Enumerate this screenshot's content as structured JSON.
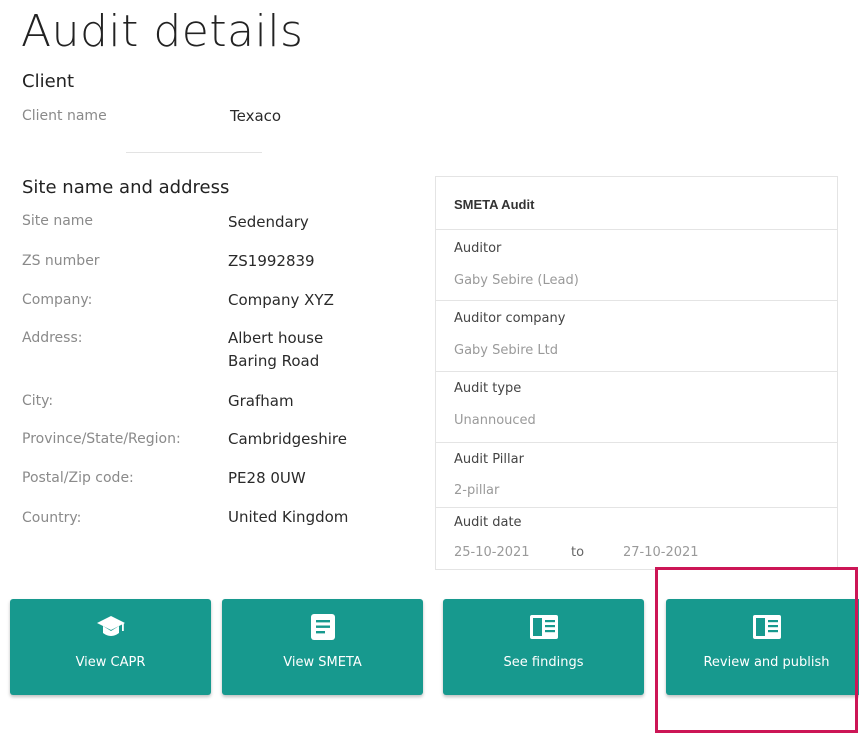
{
  "page": {
    "title": "Audit details"
  },
  "client": {
    "heading": "Client",
    "name_label": "Client name",
    "name_value": "Texaco"
  },
  "site": {
    "heading": "Site name and address",
    "fields": [
      {
        "label": "Site name",
        "value": "Sedendary"
      },
      {
        "label": "ZS number",
        "value": "ZS1992839"
      },
      {
        "label": "Company:",
        "value": "Company XYZ"
      },
      {
        "label": "Address:",
        "value": "Albert house",
        "value2": "Baring Road"
      },
      {
        "label": "City:",
        "value": "Grafham"
      },
      {
        "label": "Province/State/Region:",
        "value": "Cambridgeshire"
      },
      {
        "label": "Postal/Zip code:",
        "value": "PE28 0UW"
      },
      {
        "label": "Country:",
        "value": "United Kingdom"
      }
    ]
  },
  "audit_panel": {
    "title": "SMETA Audit",
    "rows": [
      {
        "label": "Auditor",
        "value": "Gaby Sebire (Lead)"
      },
      {
        "label": "Auditor company",
        "value": "Gaby Sebire Ltd"
      },
      {
        "label": "Audit type",
        "value": "Unannouced"
      },
      {
        "label": "Audit Pillar",
        "value": "2-pillar"
      }
    ],
    "date": {
      "label": "Audit date",
      "from": "25-10-2021",
      "separator": "to",
      "to": "27-10-2021"
    }
  },
  "actions": [
    {
      "label": "View CAPR",
      "icon": "graduation-cap-icon"
    },
    {
      "label": "View SMETA",
      "icon": "document-icon"
    },
    {
      "label": "See findings",
      "icon": "book-icon"
    },
    {
      "label": "Review and publish",
      "icon": "book-icon"
    }
  ],
  "colors": {
    "tile": "#17998e",
    "highlight": "#cc1656"
  }
}
